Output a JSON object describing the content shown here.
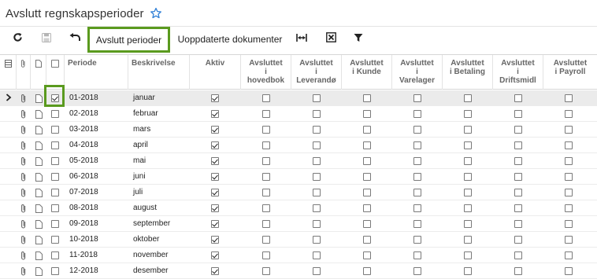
{
  "page": {
    "title": "Avslutt regnskapsperioder"
  },
  "toolbar": {
    "close_periods_label": "Avslutt perioder",
    "updated_docs_label": "Uoppdaterte dokumenter"
  },
  "columns": {
    "periode": "Periode",
    "beskrivelse": "Beskrivelse",
    "aktiv": "Aktiv",
    "hovedbok": [
      "Avsluttet",
      "i",
      "hovedbok"
    ],
    "leverandor": [
      "Avsluttet",
      "i",
      "Leverandø"
    ],
    "kunde": [
      "Avsluttet",
      "i Kunde"
    ],
    "varelager": [
      "Avsluttet",
      "i",
      "Varelager"
    ],
    "betaling": [
      "Avsluttet",
      "i Betaling"
    ],
    "driftsmidl": [
      "Avsluttet",
      "i",
      "Driftsmidl"
    ],
    "payroll": [
      "Avsluttet",
      "i Payroll"
    ]
  },
  "rows": [
    {
      "periode": "01-2018",
      "beskrivelse": "januar",
      "selected": true,
      "row_checked": true,
      "aktiv": true,
      "hovedbok": false,
      "leverandor": false,
      "kunde": false,
      "varelager": false,
      "betaling": false,
      "driftsmidl": false,
      "payroll": false
    },
    {
      "periode": "02-2018",
      "beskrivelse": "februar",
      "selected": false,
      "row_checked": false,
      "aktiv": true,
      "hovedbok": false,
      "leverandor": false,
      "kunde": false,
      "varelager": false,
      "betaling": false,
      "driftsmidl": false,
      "payroll": false
    },
    {
      "periode": "03-2018",
      "beskrivelse": "mars",
      "selected": false,
      "row_checked": false,
      "aktiv": true,
      "hovedbok": false,
      "leverandor": false,
      "kunde": false,
      "varelager": false,
      "betaling": false,
      "driftsmidl": false,
      "payroll": false
    },
    {
      "periode": "04-2018",
      "beskrivelse": "april",
      "selected": false,
      "row_checked": false,
      "aktiv": true,
      "hovedbok": false,
      "leverandor": false,
      "kunde": false,
      "varelager": false,
      "betaling": false,
      "driftsmidl": false,
      "payroll": false
    },
    {
      "periode": "05-2018",
      "beskrivelse": "mai",
      "selected": false,
      "row_checked": false,
      "aktiv": true,
      "hovedbok": false,
      "leverandor": false,
      "kunde": false,
      "varelager": false,
      "betaling": false,
      "driftsmidl": false,
      "payroll": false
    },
    {
      "periode": "06-2018",
      "beskrivelse": "juni",
      "selected": false,
      "row_checked": false,
      "aktiv": true,
      "hovedbok": false,
      "leverandor": false,
      "kunde": false,
      "varelager": false,
      "betaling": false,
      "driftsmidl": false,
      "payroll": false
    },
    {
      "periode": "07-2018",
      "beskrivelse": "juli",
      "selected": false,
      "row_checked": false,
      "aktiv": true,
      "hovedbok": false,
      "leverandor": false,
      "kunde": false,
      "varelager": false,
      "betaling": false,
      "driftsmidl": false,
      "payroll": false
    },
    {
      "periode": "08-2018",
      "beskrivelse": "august",
      "selected": false,
      "row_checked": false,
      "aktiv": true,
      "hovedbok": false,
      "leverandor": false,
      "kunde": false,
      "varelager": false,
      "betaling": false,
      "driftsmidl": false,
      "payroll": false
    },
    {
      "periode": "09-2018",
      "beskrivelse": "september",
      "selected": false,
      "row_checked": false,
      "aktiv": true,
      "hovedbok": false,
      "leverandor": false,
      "kunde": false,
      "varelager": false,
      "betaling": false,
      "driftsmidl": false,
      "payroll": false
    },
    {
      "periode": "10-2018",
      "beskrivelse": "oktober",
      "selected": false,
      "row_checked": false,
      "aktiv": true,
      "hovedbok": false,
      "leverandor": false,
      "kunde": false,
      "varelager": false,
      "betaling": false,
      "driftsmidl": false,
      "payroll": false
    },
    {
      "periode": "11-2018",
      "beskrivelse": "november",
      "selected": false,
      "row_checked": false,
      "aktiv": true,
      "hovedbok": false,
      "leverandor": false,
      "kunde": false,
      "varelager": false,
      "betaling": false,
      "driftsmidl": false,
      "payroll": false
    },
    {
      "periode": "12-2018",
      "beskrivelse": "desember",
      "selected": false,
      "row_checked": false,
      "aktiv": true,
      "hovedbok": false,
      "leverandor": false,
      "kunde": false,
      "varelager": false,
      "betaling": false,
      "driftsmidl": false,
      "payroll": false
    }
  ],
  "icons": {
    "refresh": "refresh-icon",
    "save": "save-icon",
    "undo": "undo-icon",
    "fit_columns": "fit-columns-icon",
    "export_excel": "excel-export-icon",
    "filter": "filter-icon",
    "favorite": "star-icon",
    "attachment": "paperclip-icon",
    "note": "document-icon"
  },
  "colors": {
    "highlight": "#5a9a1e",
    "star": "#2f7fd6",
    "selected_row": "#ebebeb"
  }
}
